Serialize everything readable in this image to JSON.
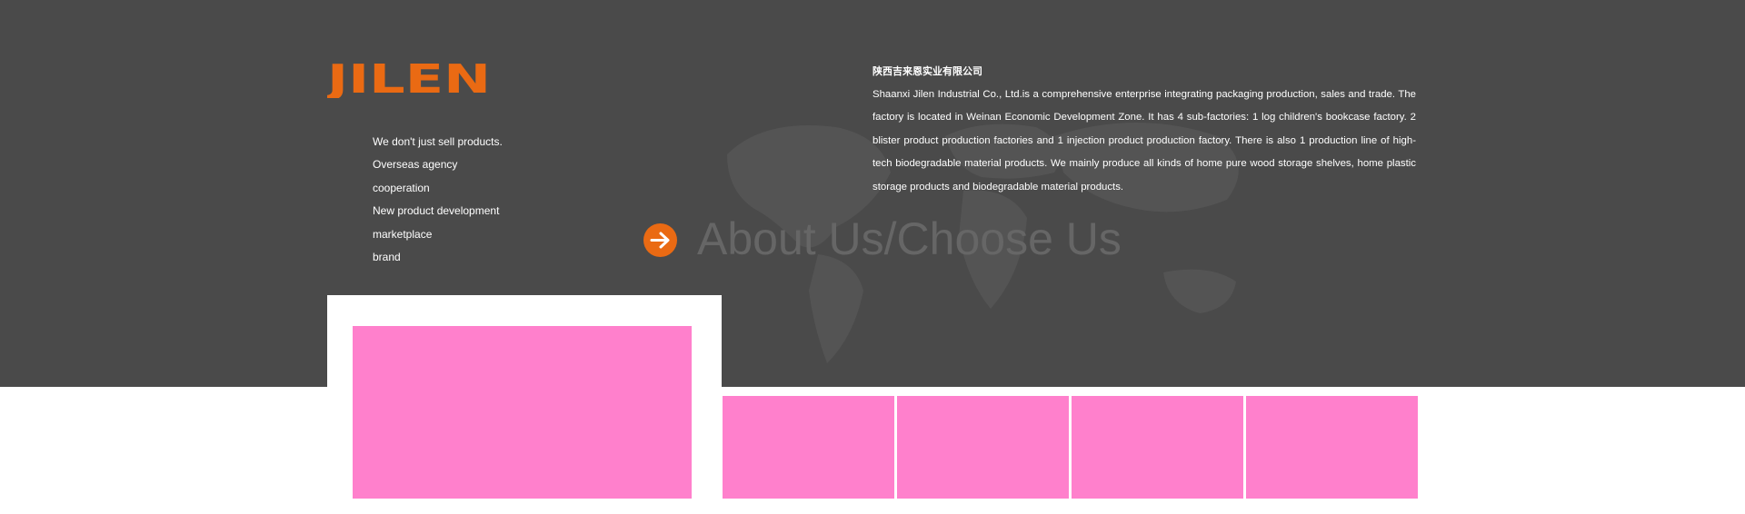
{
  "brand": {
    "logo_text": "JILEN",
    "accent_color": "#ea6a13"
  },
  "features": [
    "We don't just sell products.",
    "Overseas agency",
    "cooperation",
    "New product development",
    "marketplace",
    "brand"
  ],
  "company": {
    "name": "陕西吉来恩实业有限公司",
    "description": "Shaanxi Jilen Industrial Co., Ltd.is a comprehensive enterprise integrating packaging production, sales and trade. The factory is located in Weinan Economic Development Zone. It has 4 sub-factories: 1 log children's bookcase factory. 2 blister product production factories and 1 injection product production factory. There is also 1 production line of high-tech biodegradable material products. We mainly produce all kinds of home pure wood storage shelves, home plastic storage products and biodegradable material products."
  },
  "section": {
    "title": "About Us/Choose Us",
    "arrow_icon": "arrow-right-icon"
  },
  "colors": {
    "hero_background": "#4a4a4a",
    "image_placeholder": "#ff80cc"
  }
}
